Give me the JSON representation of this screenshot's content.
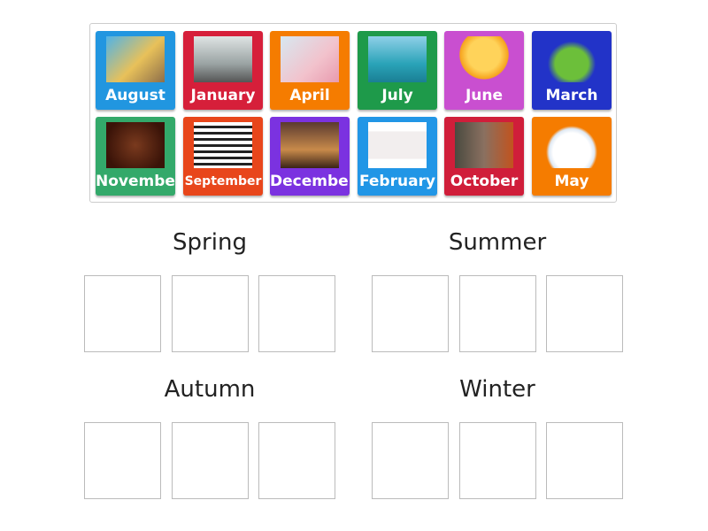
{
  "cards": [
    {
      "label": "August",
      "color": "#2196e0",
      "img": "linear-gradient(135deg,#4fb3e8,#e8c15a 55%,#8d6e4a)"
    },
    {
      "label": "January",
      "color": "#d61f3a",
      "img": "linear-gradient(180deg,#dfe4e4,#9aa3a3 60%,#555)"
    },
    {
      "label": "April",
      "color": "#f57c00",
      "img": "linear-gradient(135deg,#d7e8f0,#f2c2cc 60%,#e89aae)"
    },
    {
      "label": "July",
      "color": "#1e9a4a",
      "img": "linear-gradient(180deg,#8fd0e8,#2aa3b8 60%,#1a7f94)"
    },
    {
      "label": "June",
      "color": "#c94fd0",
      "img": "radial-gradient(circle at 50% 40%,#ffd35a 40%,#f6a31d 60%,rgba(0,0,0,0) 62%)"
    },
    {
      "label": "March",
      "color": "#2233c8",
      "img": "radial-gradient(ellipse at 50% 60%,#6cbf3a 40%,rgba(0,0,0,0) 58%)"
    },
    {
      "label": "November",
      "color": "#33a96a",
      "img": "radial-gradient(circle,#7a3a1e,#3a1308 80%)"
    },
    {
      "label": "September",
      "color": "#e8461b",
      "img": "repeating-linear-gradient(180deg,#fff 0 4px,#222 4px 7px)"
    },
    {
      "label": "December",
      "color": "#7b32e0",
      "img": "linear-gradient(180deg,#5a3a30,#c88a4a 60%,#3a2418)"
    },
    {
      "label": "February",
      "color": "#2196e6",
      "img": "linear-gradient(180deg,#fff 20%,#f2eeee 20%,#f2eeee 80%,#fff 80%)"
    },
    {
      "label": "October",
      "color": "#d01e3a",
      "img": "linear-gradient(90deg,#4a4a40,#8a7060 50%,#c2531e)"
    },
    {
      "label": "May",
      "color": "#f57c00",
      "img": "radial-gradient(ellipse at 50% 65%,#fff 45%,#dfe9f4 55%,rgba(0,0,0,0) 62%)"
    }
  ],
  "groups": [
    {
      "title": "Spring"
    },
    {
      "title": "Summer"
    },
    {
      "title": "Autumn"
    },
    {
      "title": "Winter"
    }
  ]
}
